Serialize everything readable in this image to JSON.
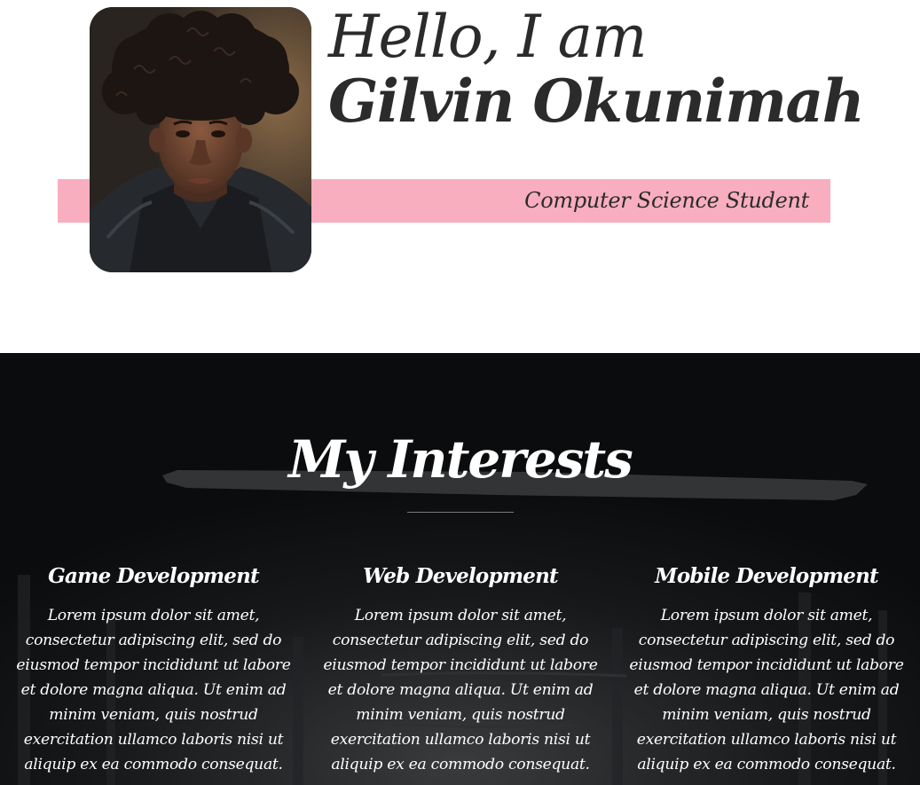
{
  "hero": {
    "greeting": "Hello, I am",
    "name": "Gilvin Okunimah",
    "role": "Computer Science Student",
    "accent_color": "#f8aebf",
    "photo_alt": "Portrait of Gilvin Okunimah"
  },
  "interests": {
    "title": "My Interests",
    "items": [
      {
        "title": "Game Development",
        "description": "Lorem ipsum dolor sit amet, consectetur adipiscing elit, sed do eiusmod tempor incididunt ut labore et dolore magna aliqua. Ut enim ad minim veniam, quis nostrud exercitation ullamco laboris nisi ut aliquip ex ea commodo consequat."
      },
      {
        "title": "Web Development",
        "description": "Lorem ipsum dolor sit amet, consectetur adipiscing elit, sed do eiusmod tempor incididunt ut labore et dolore magna aliqua. Ut enim ad minim veniam, quis nostrud exercitation ullamco laboris nisi ut aliquip ex ea commodo consequat."
      },
      {
        "title": "Mobile Development",
        "description": "Lorem ipsum dolor sit amet, consectetur adipiscing elit, sed do eiusmod tempor incididunt ut labore et dolore magna aliqua. Ut enim ad minim veniam, quis nostrud exercitation ullamco laboris nisi ut aliquip ex ea commodo consequat."
      }
    ]
  }
}
